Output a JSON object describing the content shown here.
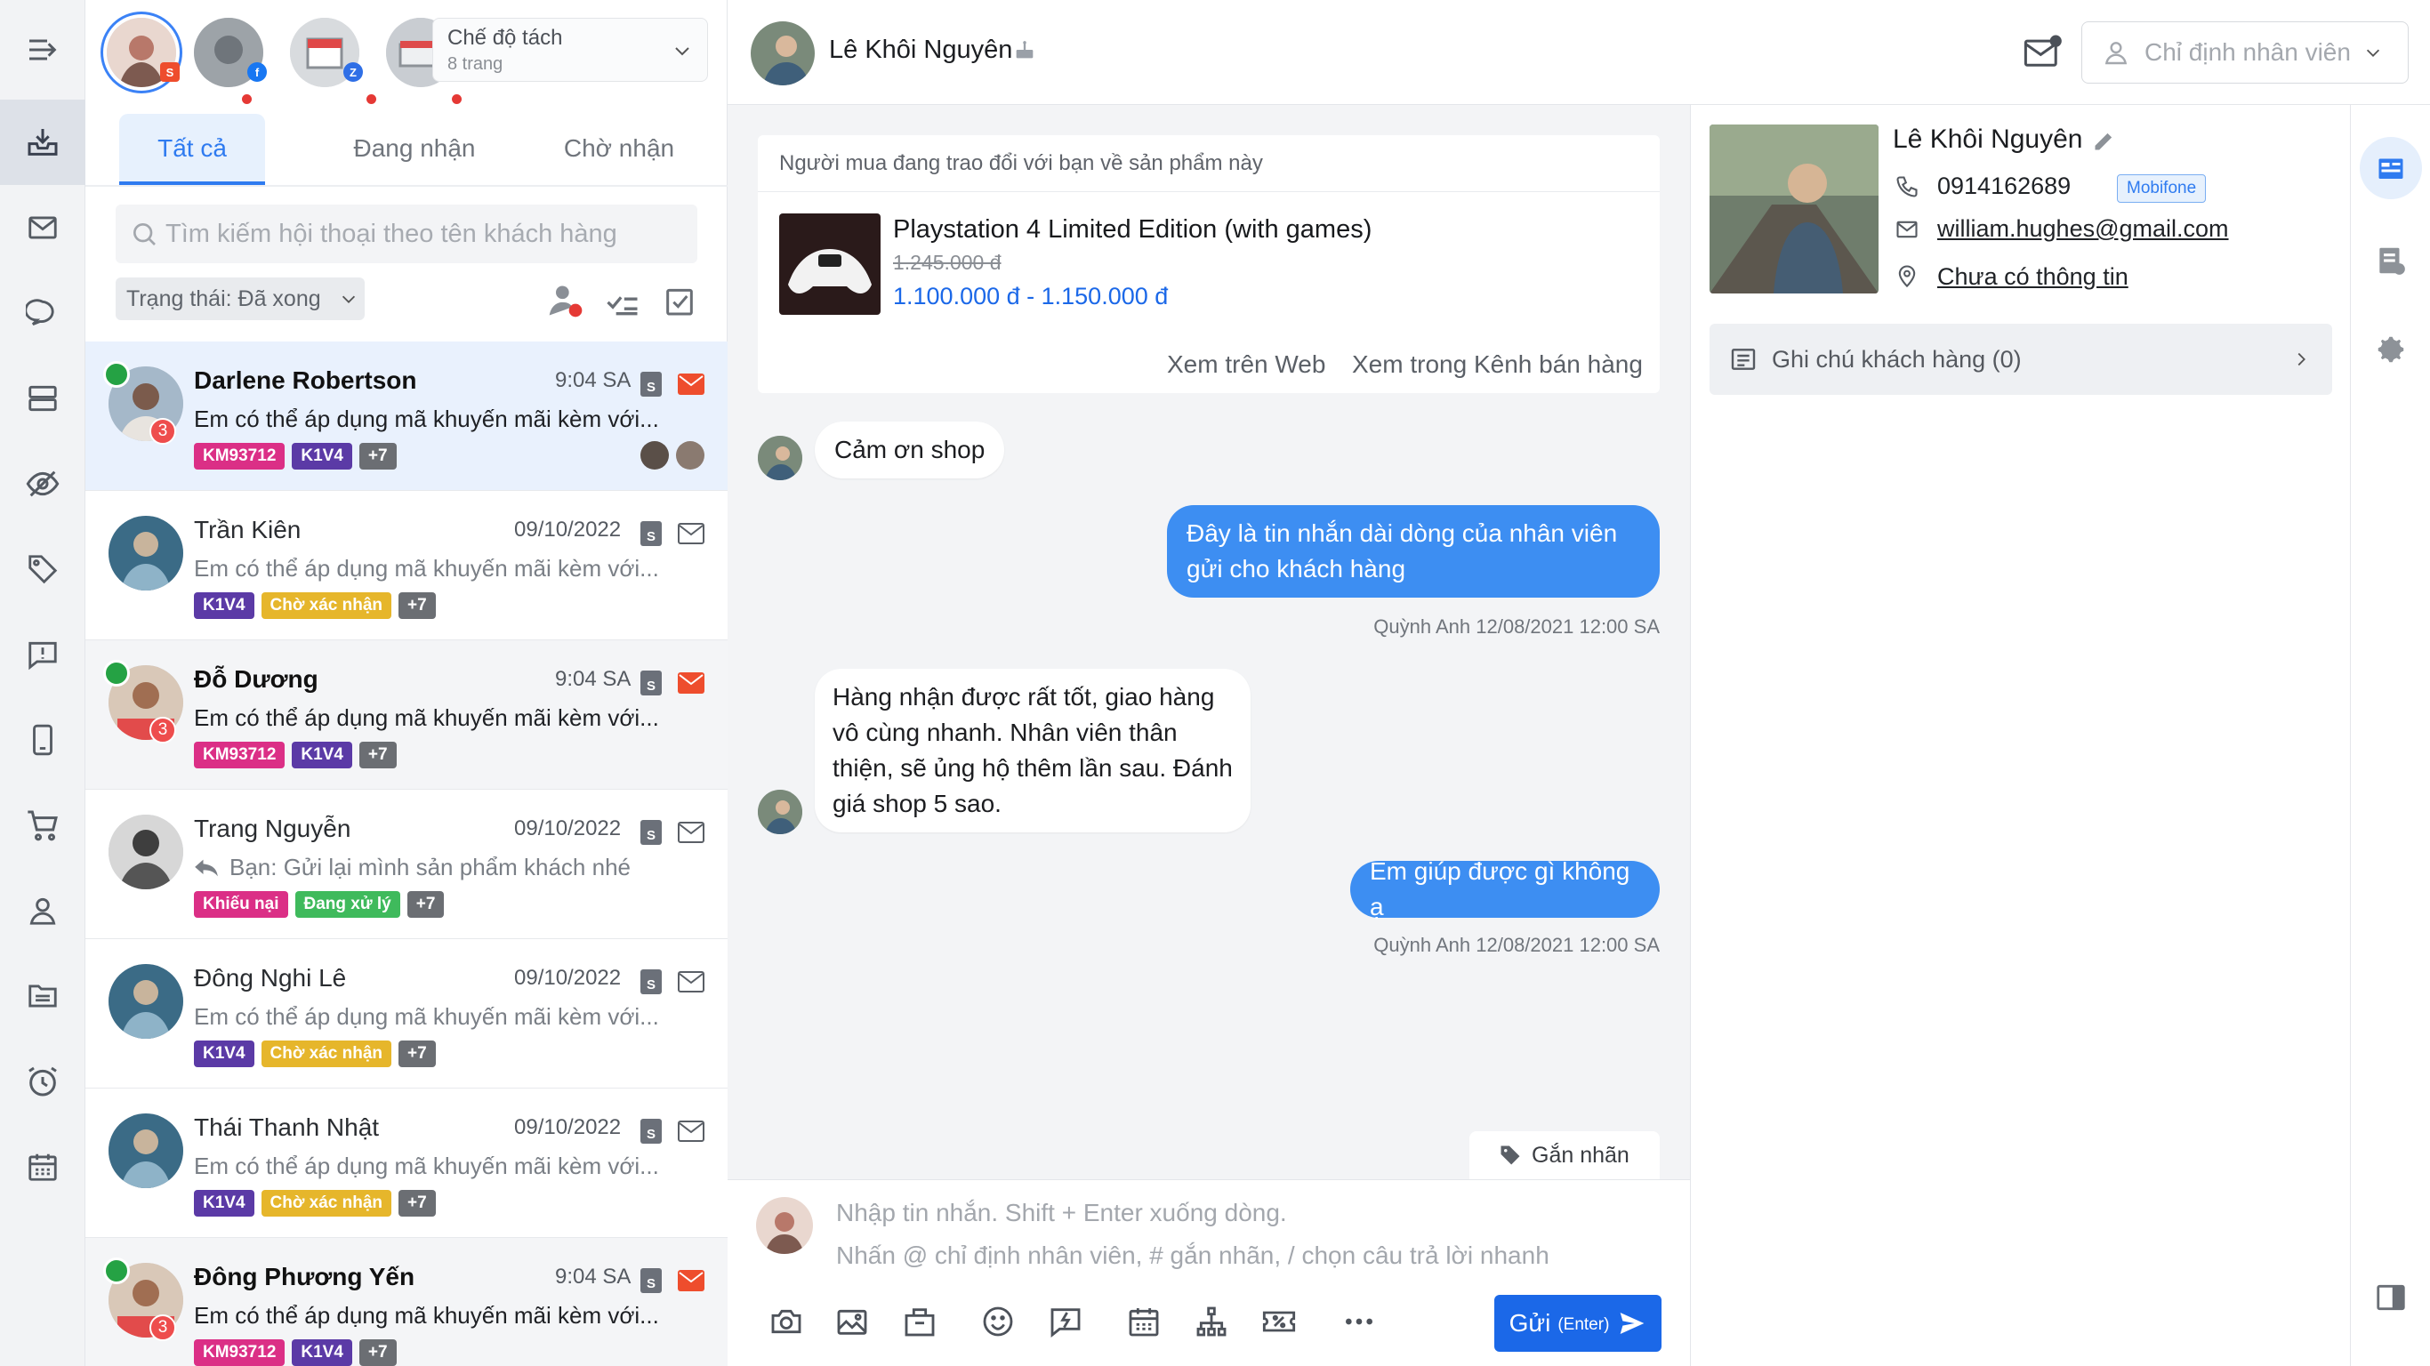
{
  "rail": {
    "items": [
      "menu-toggle-icon",
      "inbox-icon",
      "mail-icon",
      "chat-bubble-icon",
      "server-icon",
      "eye-off-icon",
      "tag-icon",
      "feedback-icon",
      "mobile-icon",
      "cart-icon",
      "user-icon",
      "folder-icon",
      "alarm-icon",
      "calendar-icon"
    ],
    "active": "inbox-icon"
  },
  "mode": {
    "title": "Chế độ tách",
    "subtitle": "8 trang"
  },
  "tabs": [
    {
      "label": "Tất cả",
      "active": true
    },
    {
      "label": "Đang nhận",
      "active": false
    },
    {
      "label": "Chờ nhận",
      "active": false
    }
  ],
  "search": {
    "placeholder": "Tìm kiếm hội thoại theo tên khách hàng"
  },
  "status_filter": {
    "label": "Trạng thái: Đã xong"
  },
  "conversations": [
    {
      "name": "Darlene Robertson",
      "time": "9:04 SA",
      "message": "Em có thể áp dụng mã khuyến mãi kèm với...",
      "unread": "3",
      "tags": [
        "KM93712",
        "K1V4",
        "+7"
      ]
    },
    {
      "name": "Trần Kiên",
      "time": "09/10/2022",
      "message": "Em có thể áp dụng mã khuyến mãi kèm với...",
      "tags": [
        "K1V4",
        "Chờ xác nhận",
        "+7"
      ]
    },
    {
      "name": "Đỗ Dương",
      "time": "9:04 SA",
      "message": "Em có thể áp dụng mã khuyến mãi kèm với...",
      "unread": "3",
      "tags": [
        "KM93712",
        "K1V4",
        "+7"
      ]
    },
    {
      "name": "Trang Nguyễn",
      "time": "09/10/2022",
      "message": "Bạn: Gửi lại mình sản phẩm khách nhé",
      "tags": [
        "Khiếu nại",
        "Đang xử lý",
        "+7"
      ]
    },
    {
      "name": "Đông Nghi Lê",
      "time": "09/10/2022",
      "message": "Em có thể áp dụng mã khuyến mãi kèm với...",
      "tags": [
        "K1V4",
        "Chờ xác nhận",
        "+7"
      ]
    },
    {
      "name": "Thái Thanh Nhật",
      "time": "09/10/2022",
      "message": "Em có thể áp dụng mã khuyến mãi kèm với...",
      "tags": [
        "K1V4",
        "Chờ xác nhận",
        "+7"
      ]
    },
    {
      "name": "Đông Phương Yến",
      "time": "9:04 SA",
      "message": "Em có thể áp dụng mã khuyến mãi kèm với...",
      "unread": "3",
      "tags": [
        "KM93712",
        "K1V4",
        "+7"
      ]
    }
  ],
  "header": {
    "customer_name": "Lê Khôi Nguyên",
    "assign_placeholder": "Chỉ định nhân viên"
  },
  "product": {
    "notice": "Người mua đang trao đổi với bạn về sản phẩm này",
    "name": "Playstation 4 Limited Edition (with games)",
    "old_price": "1.245.000 đ",
    "price_range": "1.100.000 đ -  1.150.000 đ",
    "link_web": "Xem trên Web",
    "link_channel": "Xem trong Kênh bán hàng"
  },
  "messages": {
    "m1": "Cảm ơn shop",
    "m2": "Đây là tin nhắn dài dòng của nhân viên gửi cho khách hàng",
    "m2_meta": "Quỳnh Anh 12/08/2021 12:00 SA",
    "m3": "Hàng nhận được rất tốt, giao hàng vô cùng nhanh. Nhân viên thân thiện, sẽ ủng hộ thêm lần sau. Đánh giá shop 5 sao.",
    "m4": "Em giúp được gì không ạ",
    "m4_meta": "Quỳnh Anh 12/08/2021 12:00 SA"
  },
  "tag_button": "Gắn nhãn",
  "composer": {
    "line1": "Nhập tin nhắn. Shift + Enter xuống dòng.",
    "line2": "Nhấn @ chỉ định nhân viên, # gắn nhãn, / chọn câu trả lời nhanh",
    "send_label": "Gửi",
    "send_hint": "(Enter)"
  },
  "profile": {
    "name": "Lê Khôi Nguyên",
    "phone": "0914162689",
    "carrier": "Mobifone",
    "email": "william.hughes@gmail.com",
    "address": "Chưa có thông tin",
    "note": "Ghi chú khách hàng (0)"
  }
}
